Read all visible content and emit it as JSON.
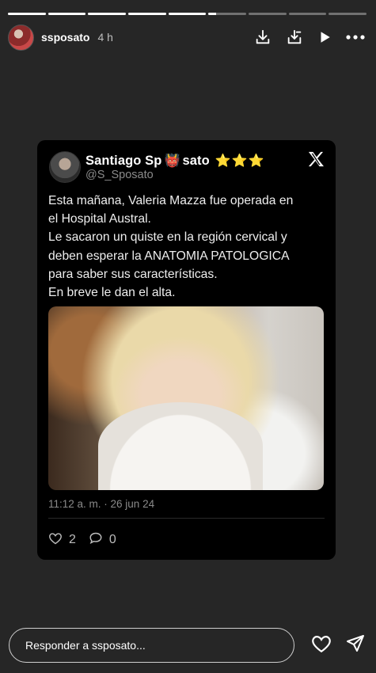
{
  "progress": [
    1,
    1,
    1,
    1,
    1,
    0.2,
    0,
    0,
    0
  ],
  "header": {
    "username": "ssposato",
    "time": "4 h",
    "icons": [
      "download-icon",
      "save-icon",
      "play-icon",
      "more-icon"
    ]
  },
  "tweet": {
    "name": "Santiago Sp",
    "name_emoji": "👹",
    "name_tail": "sato",
    "stars": "⭐⭐⭐",
    "handle": "@S_Sposato",
    "text": "Esta mañana, Valeria Mazza fue operada en\nel Hospital Austral.\nLe sacaron un quiste en la región cervical y\ndeben esperar la ANATOMIA PATOLOGICA\npara saber sus características.\nEn breve le dan el alta.",
    "meta": "11:12 a. m. · 26 jun 24",
    "likes": "2",
    "replies": "0"
  },
  "footer": {
    "placeholder": "Responder a ssposato..."
  }
}
